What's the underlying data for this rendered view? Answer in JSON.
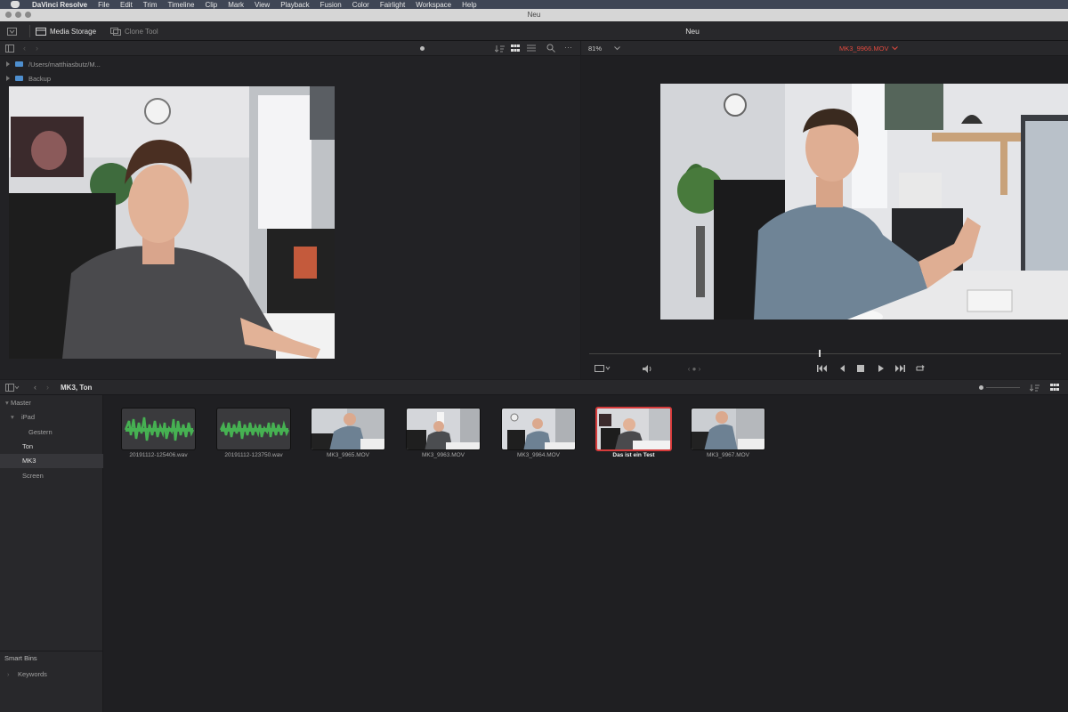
{
  "menubar": {
    "app_name": "DaVinci Resolve",
    "items": [
      "File",
      "Edit",
      "Trim",
      "Timeline",
      "Clip",
      "Mark",
      "View",
      "Playback",
      "Fusion",
      "Color",
      "Fairlight",
      "Workspace",
      "Help"
    ]
  },
  "window": {
    "title": "Neu"
  },
  "toolbar": {
    "media_storage": "Media Storage",
    "clone_tool": "Clone Tool",
    "project_title": "Neu"
  },
  "media_storage": {
    "locations": [
      {
        "label": "/Users/matthiasbutz/M..."
      },
      {
        "label": "Backup"
      }
    ]
  },
  "viewer": {
    "zoom": "81%",
    "clip_name": "MK3_9966.MOV",
    "clip_name_color": "#e04a3f"
  },
  "media_pool": {
    "breadcrumb": "MK3, Ton",
    "bins": [
      {
        "label": "Master",
        "level": 0
      },
      {
        "label": "iPad",
        "level": 1
      },
      {
        "label": "Gestern",
        "level": 2
      },
      {
        "label": "Ton",
        "level": 1
      },
      {
        "label": "MK3",
        "level": 1
      },
      {
        "label": "Screen",
        "level": 1
      }
    ],
    "smart_bins_title": "Smart Bins",
    "smart_bins": [
      {
        "label": "Keywords"
      }
    ],
    "clips": [
      {
        "name": "20191112-125406.wav",
        "kind": "audio"
      },
      {
        "name": "20191112-123750.wav",
        "kind": "audio"
      },
      {
        "name": "MK3_9965.MOV",
        "kind": "video"
      },
      {
        "name": "MK3_9963.MOV",
        "kind": "video"
      },
      {
        "name": "MK3_9964.MOV",
        "kind": "video"
      },
      {
        "name": "Das ist ein Test",
        "kind": "video"
      },
      {
        "name": "MK3_9967.MOV",
        "kind": "video"
      }
    ],
    "selected_clip": "Das ist ein Test"
  },
  "colors": {
    "accent_red": "#d63b3b",
    "waveform_green": "#3fa34d",
    "panel": "#28282b",
    "panel_dark": "#1c1c1f"
  },
  "icons": [
    "apple-icon",
    "panel-toggle-icon",
    "media-storage-icon",
    "clone-tool-icon",
    "sort-icon",
    "grid-view-icon",
    "list-view-icon",
    "search-icon",
    "more-icon",
    "audio-icon",
    "first-frame-icon",
    "prev-frame-icon",
    "stop-icon",
    "play-icon",
    "last-frame-icon",
    "loop-icon",
    "chevron-down-icon"
  ]
}
